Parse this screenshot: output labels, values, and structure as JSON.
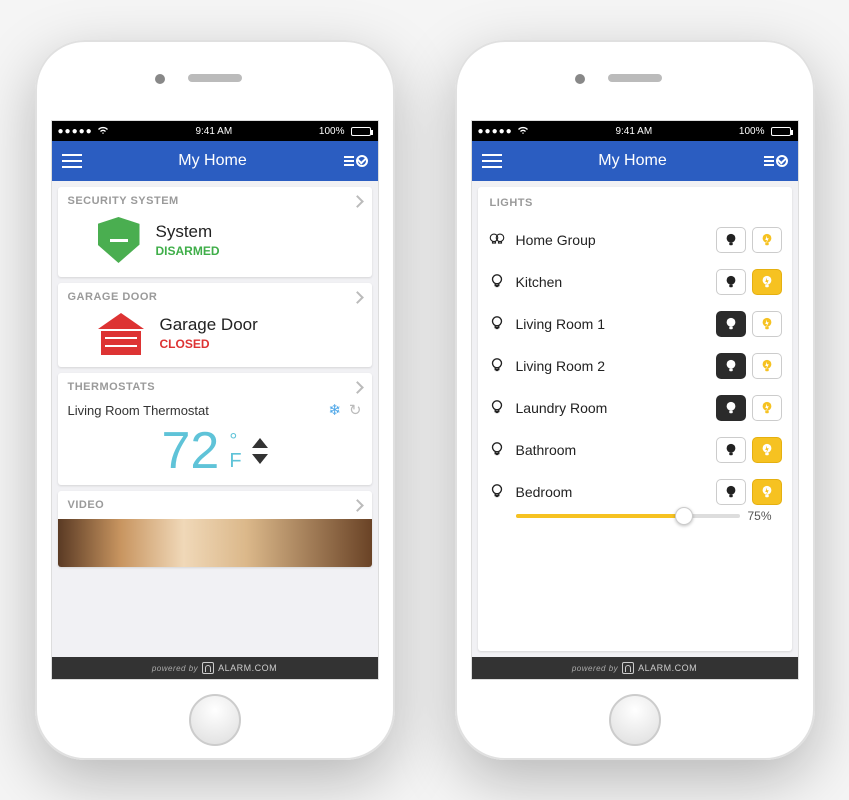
{
  "statusBar": {
    "time": "9:41 AM",
    "battery": "100%"
  },
  "nav": {
    "title": "My Home"
  },
  "phone1": {
    "security": {
      "header": "SECURITY SYSTEM",
      "name": "System",
      "state": "DISARMED"
    },
    "garage": {
      "header": "GARAGE DOOR",
      "name": "Garage Door",
      "state": "CLOSED"
    },
    "thermostat": {
      "header": "THERMOSTATS",
      "name": "Living Room Thermostat",
      "temp": "72",
      "deg": "°",
      "unit": "F"
    },
    "video": {
      "header": "VIDEO"
    }
  },
  "phone2": {
    "lightsHeader": "LIGHTS",
    "lights": [
      {
        "name": "Home Group",
        "offActive": false,
        "onActive": false,
        "group": true
      },
      {
        "name": "Kitchen",
        "offActive": false,
        "onActive": true
      },
      {
        "name": "Living Room 1",
        "offActive": true,
        "onActive": false
      },
      {
        "name": "Living Room 2",
        "offActive": true,
        "onActive": false
      },
      {
        "name": "Laundry Room",
        "offActive": true,
        "onActive": false
      },
      {
        "name": "Bathroom",
        "offActive": false,
        "onActive": true
      },
      {
        "name": "Bedroom",
        "offActive": false,
        "onActive": true,
        "dimmer": 75
      }
    ]
  },
  "footer": {
    "poweredBy": "powered by",
    "brand": "ALARM.COM"
  }
}
